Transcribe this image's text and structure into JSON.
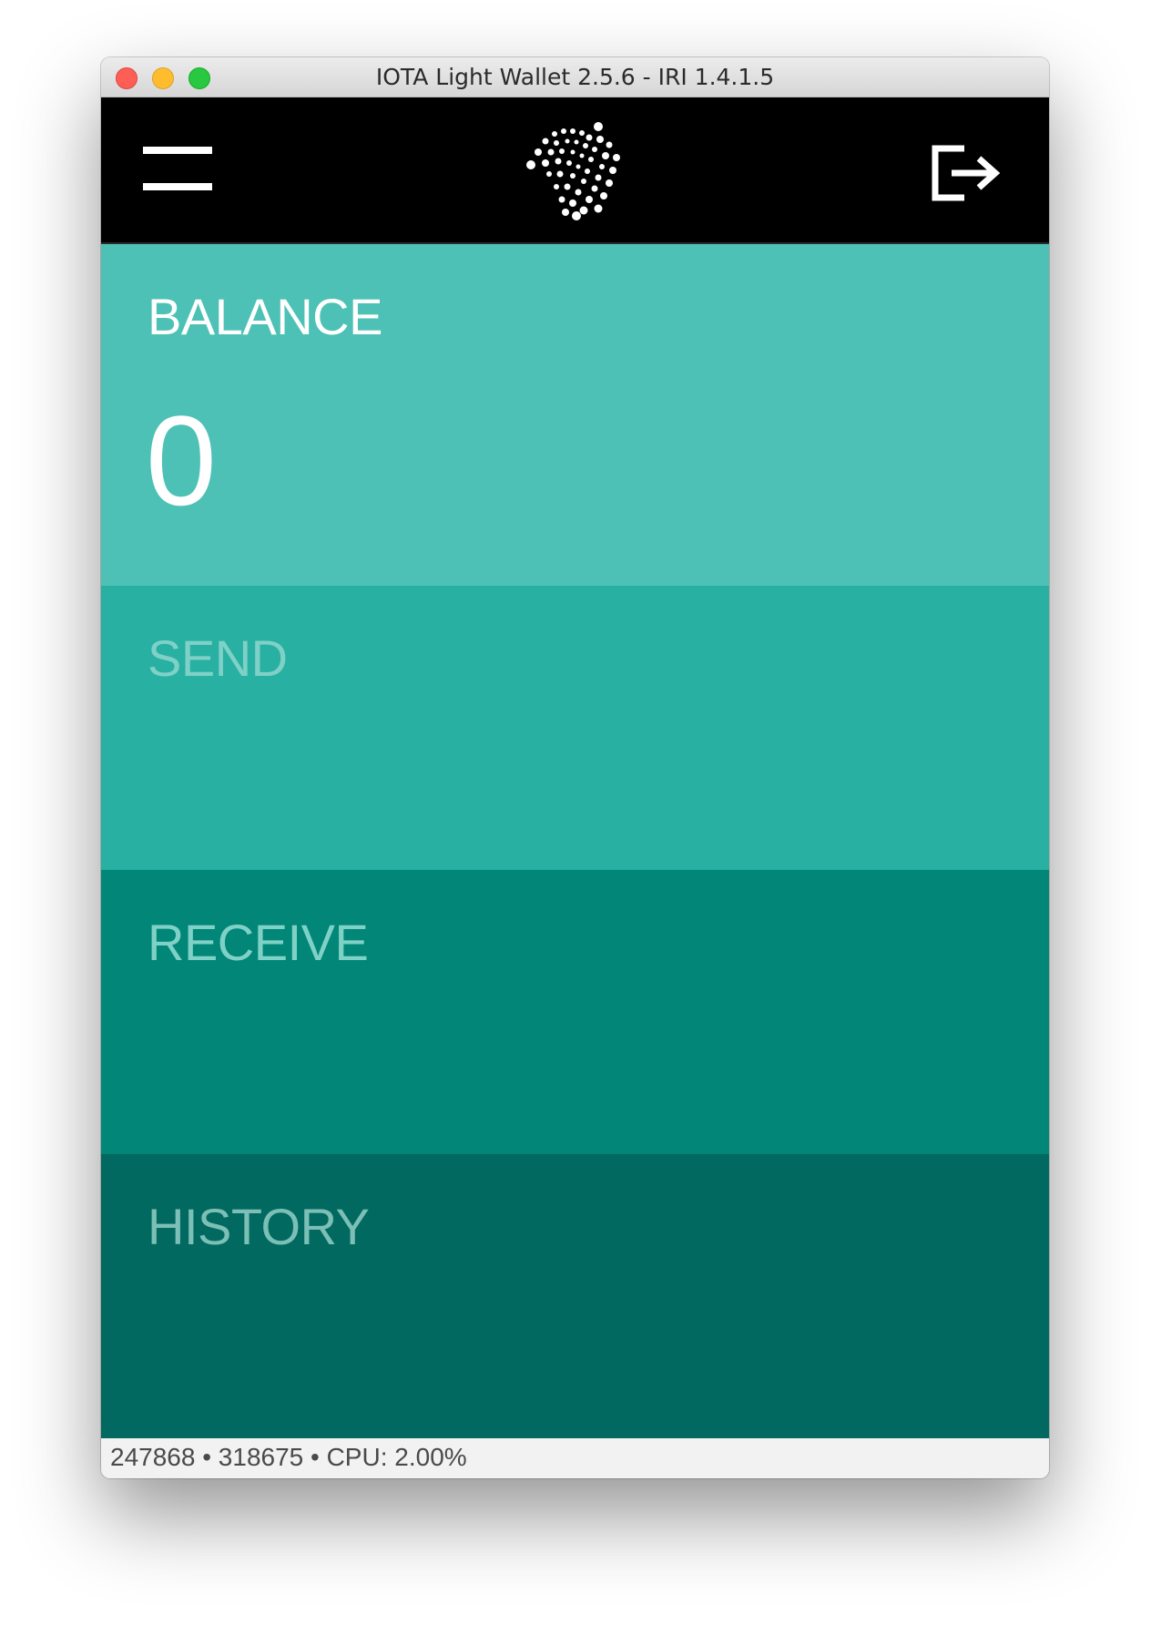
{
  "window": {
    "title": "IOTA Light Wallet 2.5.6 - IRI 1.4.1.5"
  },
  "header": {
    "menu_icon": "hamburger-menu-icon",
    "logo_icon": "iota-logo-icon",
    "logout_icon": "logout-icon"
  },
  "sections": {
    "balance": {
      "label": "BALANCE",
      "value": "0"
    },
    "send": {
      "label": "SEND"
    },
    "receive": {
      "label": "RECEIVE"
    },
    "history": {
      "label": "HISTORY"
    }
  },
  "status": {
    "text": "247868 • 318675 • CPU: 2.00%"
  },
  "colors": {
    "header_bg": "#000000",
    "balance_bg": "#4dc1b6",
    "send_bg": "#28b0a3",
    "receive_bg": "#018677",
    "history_bg": "#01695f"
  }
}
